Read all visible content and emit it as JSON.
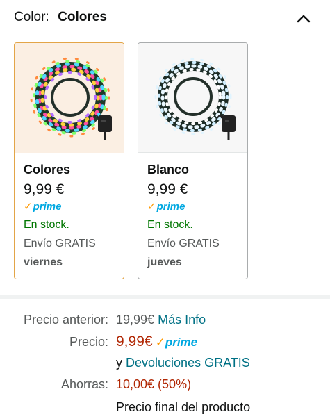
{
  "color_selector": {
    "label": "Color:",
    "selected_value": "Colores"
  },
  "variants": [
    {
      "name": "Colores",
      "price": "9,99 €",
      "prime_check": "✓",
      "prime_label": "prime",
      "stock": "En stock.",
      "shipping": "Envío GRATIS",
      "delivery_day": "viernes",
      "selected": true
    },
    {
      "name": "Blanco",
      "price": "9,99 €",
      "prime_check": "✓",
      "prime_label": "prime",
      "stock": "En stock.",
      "shipping": "Envío GRATIS",
      "delivery_day": "jueves",
      "selected": false
    }
  ],
  "pricing": {
    "previous_label": "Precio anterior:",
    "previous_price": "19,99€",
    "more_info_link": "Más Info",
    "price_label": "Precio:",
    "price": "9,99€",
    "prime_check": "✓",
    "prime_label": "prime",
    "returns_prefix": "y",
    "returns_link": "Devoluciones GRATIS",
    "savings_label": "Ahorras:",
    "savings": "10,00€ (50%)",
    "final_price_note": "Precio final del producto"
  },
  "colors": {
    "selected_border": "#e3a547",
    "link": "#007185",
    "price_red": "#b12704",
    "stock_green": "#007600",
    "prime_blue": "#00a8e1"
  },
  "icons": {
    "collapse": "chevron-up-icon",
    "plug": "power-adapter-icon"
  }
}
